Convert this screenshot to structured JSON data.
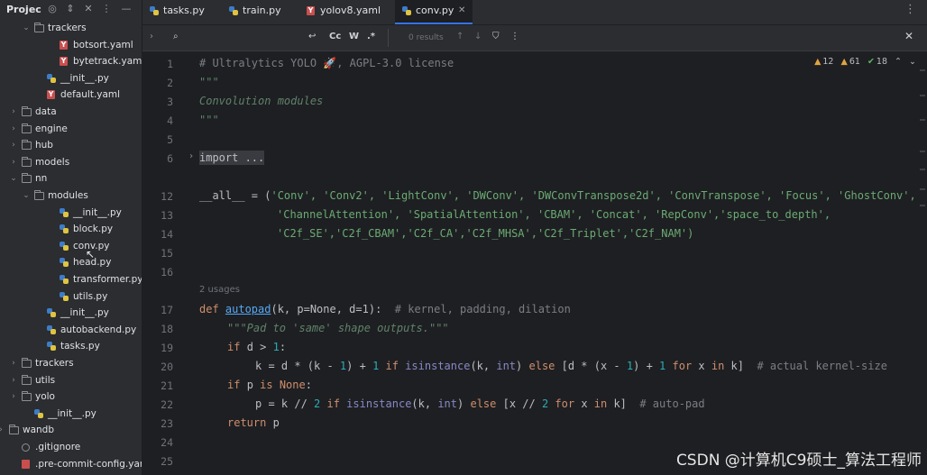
{
  "sidebar": {
    "title": "Projec",
    "tree": [
      {
        "label": "trackers",
        "type": "folder",
        "expanded": true
      },
      {
        "label": "botsort.yaml",
        "type": "yaml"
      },
      {
        "label": "bytetrack.yaml",
        "type": "yaml"
      },
      {
        "label": "__init__.py",
        "type": "py"
      },
      {
        "label": "default.yaml",
        "type": "yaml"
      },
      {
        "label": "data",
        "type": "folder",
        "expanded": false
      },
      {
        "label": "engine",
        "type": "folder",
        "expanded": false
      },
      {
        "label": "hub",
        "type": "folder",
        "expanded": false
      },
      {
        "label": "models",
        "type": "folder",
        "expanded": false
      },
      {
        "label": "nn",
        "type": "folder",
        "expanded": true
      },
      {
        "label": "modules",
        "type": "folder",
        "expanded": true
      },
      {
        "label": "__init__.py",
        "type": "py"
      },
      {
        "label": "block.py",
        "type": "py"
      },
      {
        "label": "conv.py",
        "type": "py"
      },
      {
        "label": "head.py",
        "type": "py"
      },
      {
        "label": "transformer.py",
        "type": "py"
      },
      {
        "label": "utils.py",
        "type": "py"
      },
      {
        "label": "__init__.py",
        "type": "py"
      },
      {
        "label": "autobackend.py",
        "type": "py"
      },
      {
        "label": "tasks.py",
        "type": "py"
      },
      {
        "label": "trackers",
        "type": "folder",
        "expanded": false
      },
      {
        "label": "utils",
        "type": "folder",
        "expanded": false
      },
      {
        "label": "yolo",
        "type": "folder",
        "expanded": false
      },
      {
        "label": "__init__.py",
        "type": "py"
      },
      {
        "label": "wandb",
        "type": "folder",
        "expanded": false
      },
      {
        "label": ".gitignore",
        "type": "git"
      },
      {
        "label": ".pre-commit-config.yam",
        "type": "cfg"
      }
    ]
  },
  "tabs": [
    {
      "label": "tasks.py",
      "type": "py",
      "active": false
    },
    {
      "label": "train.py",
      "type": "py",
      "active": false
    },
    {
      "label": "yolov8.yaml",
      "type": "yaml",
      "active": false
    },
    {
      "label": "conv.py",
      "type": "py",
      "active": true
    }
  ],
  "findbar": {
    "search_icon": "search-icon",
    "match_case": "Cc",
    "words": "W",
    "regex": ".*",
    "results": "0 results"
  },
  "inspections": {
    "warnings": "12",
    "weak": "61",
    "ok": "18"
  },
  "editor": {
    "usages": "2 usages",
    "lines": [
      "1",
      "2",
      "3",
      "4",
      "5",
      "6",
      "11",
      "12",
      "13",
      "14",
      "15",
      "16",
      "17",
      "18",
      "19",
      "20",
      "21",
      "22",
      "23",
      "24",
      "25"
    ],
    "code": {
      "l1": "# Ultralytics YOLO 🚀, AGPL-3.0 license",
      "l2": "\"\"\"",
      "l3": "Convolution modules",
      "l4": "\"\"\"",
      "l6": "import ...",
      "l12_a": "__all__ = (",
      "l12_b": "'Conv', 'Conv2', 'LightConv', 'DWConv', 'DWConvTranspose2d', 'ConvTranspose', 'Focus', 'GhostConv',",
      "l13": "'ChannelAttention', 'SpatialAttention', 'CBAM', 'Concat', 'RepConv','space_to_depth',",
      "l14": "'C2f_SE','C2f_CBAM','C2f_CA','C2f_MHSA','C2f_Triplet','C2f_NAM')",
      "l17_def": "def ",
      "l17_fn": "autopad",
      "l17_args": "(k, p=None, d=1):  ",
      "l17_cmt": "# kernel, padding, dilation",
      "l18": "\"\"\"Pad to 'same' shape outputs.\"\"\"",
      "l19_kw": "if ",
      "l19_rest": "d > ",
      "l19_num": "1",
      "l19_end": ":",
      "l20_a": "k = d * (k - ",
      "l20_b": "1",
      "l20_c": ") + ",
      "l20_d": "1",
      "l20_e": " if ",
      "l20_f": "isinstance",
      "l20_g": "(k, ",
      "l20_h": "int",
      "l20_i": ") ",
      "l20_j": "else",
      "l20_k": " [d * (x - ",
      "l20_l": "1",
      "l20_m": ") + ",
      "l20_n": "1",
      "l20_o": " for ",
      "l20_p": "x ",
      "l20_q": "in ",
      "l20_r": "k]  ",
      "l20_s": "# actual kernel-size",
      "l21_kw": "if ",
      "l21_rest": "p ",
      "l21_is": "is ",
      "l21_none": "None",
      "l21_end": ":",
      "l22_a": "p = k // ",
      "l22_b": "2",
      "l22_c": " if ",
      "l22_d": "isinstance",
      "l22_e": "(k, ",
      "l22_f": "int",
      "l22_g": ") ",
      "l22_h": "else",
      "l22_i": " [x // ",
      "l22_j": "2",
      "l22_k": " for ",
      "l22_l": "x ",
      "l22_m": "in ",
      "l22_n": "k]  ",
      "l22_o": "# auto-pad",
      "l23_kw": "return ",
      "l23_rest": "p"
    }
  },
  "watermark": "CSDN @计算机C9硕士_算法工程师",
  "colors": {
    "accent": "#3574f0",
    "keyword": "#cf8e6d",
    "string": "#6aab73",
    "number": "#2aacb8",
    "function": "#56a8f5"
  }
}
